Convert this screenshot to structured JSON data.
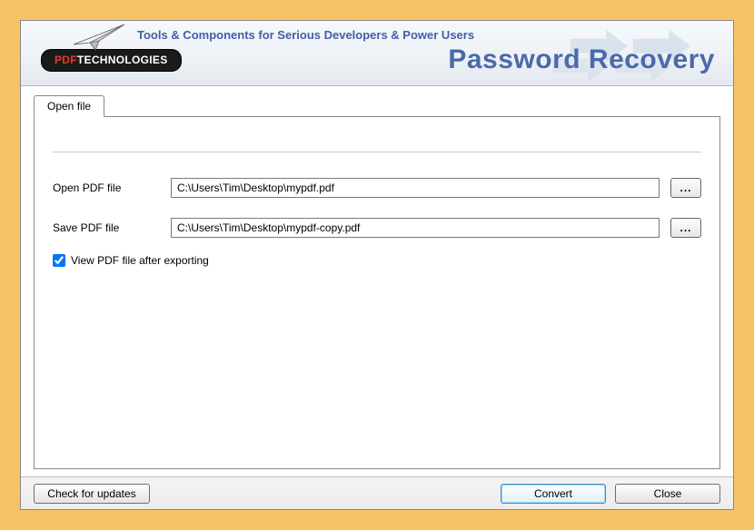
{
  "header": {
    "tagline": "Tools & Components for Serious Developers & Power Users",
    "product_title": "Password Recovery",
    "logo_prefix": "PDF",
    "logo_suffix": "TECHNOLOGIES"
  },
  "tabs": {
    "open_file": "Open file"
  },
  "form": {
    "open_label": "Open PDF file",
    "open_value": "C:\\Users\\Tim\\Desktop\\mypdf.pdf",
    "save_label": "Save PDF file",
    "save_value": "C:\\Users\\Tim\\Desktop\\mypdf-copy.pdf",
    "browse_label": "...",
    "view_after_label": "View PDF file after exporting",
    "view_after_checked": true
  },
  "footer": {
    "check_updates": "Check for updates",
    "convert": "Convert",
    "close": "Close"
  }
}
